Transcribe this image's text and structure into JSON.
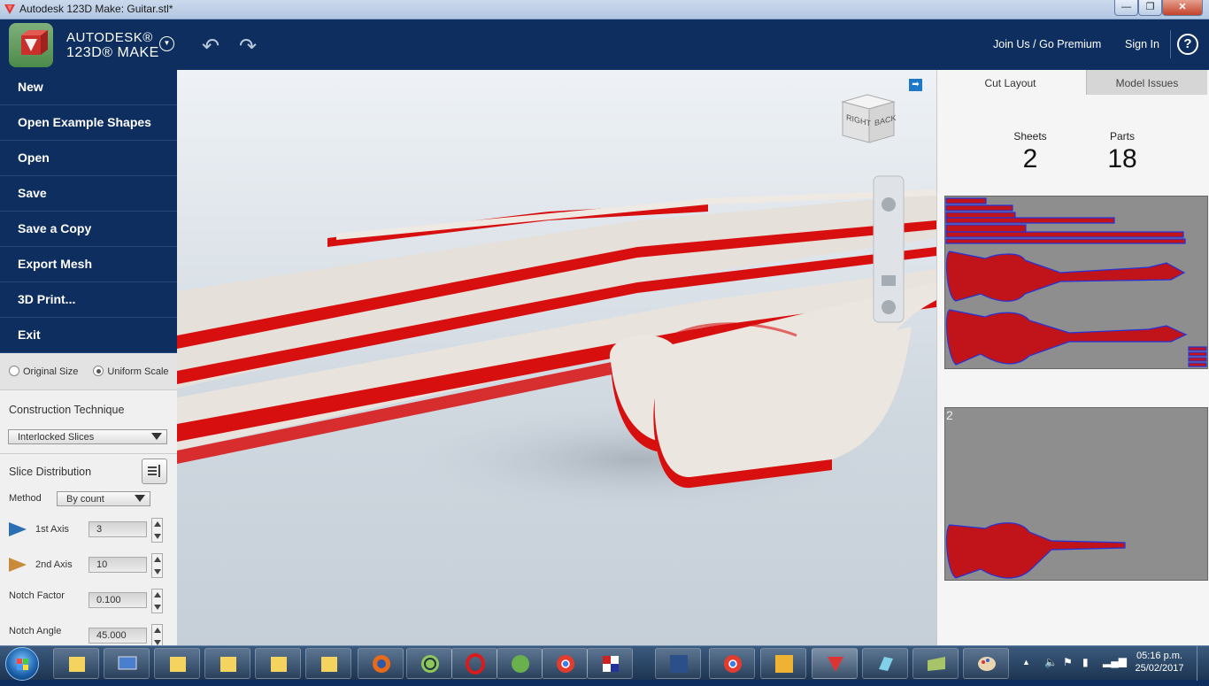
{
  "window": {
    "title": "Autodesk 123D Make: Guitar.stl*",
    "controls": {
      "minimize": "—",
      "maximize": "❐",
      "close": "✕"
    }
  },
  "header": {
    "brand_line1": "AUTODESK®",
    "brand_line2": "123D® MAKE",
    "undo_icon": "↶",
    "redo_icon": "↷",
    "join_label": "Join Us / Go Premium",
    "signin_label": "Sign In",
    "help_label": "?"
  },
  "sidebar": {
    "menu": [
      "New",
      "Open Example Shapes",
      "Open",
      "Save",
      "Save a Copy",
      "Export Mesh",
      "3D Print...",
      "Exit"
    ],
    "scale": {
      "original": "Original Size",
      "uniform": "Uniform Scale",
      "selected": "uniform"
    },
    "construction": {
      "title": "Construction Technique",
      "value": "Interlocked Slices"
    },
    "slice": {
      "title": "Slice Distribution",
      "method_label": "Method",
      "method_value": "By count",
      "axis1_label": "1st Axis",
      "axis1_value": "3",
      "axis2_label": "2nd Axis",
      "axis2_value": "10",
      "notch_factor_label": "Notch Factor",
      "notch_factor_value": "0.100",
      "notch_angle_label": "Notch Angle",
      "notch_angle_value": "45.000"
    }
  },
  "viewport": {
    "viewcube": {
      "right": "RIGHT",
      "back": "BACK"
    },
    "colors": {
      "slice_face": "#e7e2dc",
      "slice_edge": "#d80f0f"
    }
  },
  "right_panel": {
    "tabs": [
      "Cut Layout",
      "Model Issues"
    ],
    "active_tab": 0,
    "sheets_label": "Sheets",
    "sheets_value": "2",
    "parts_label": "Parts",
    "parts_value": "18",
    "sheet2_label": "2"
  },
  "taskbar": {
    "time": "05:16 p.m.",
    "date": "25/02/2017"
  }
}
